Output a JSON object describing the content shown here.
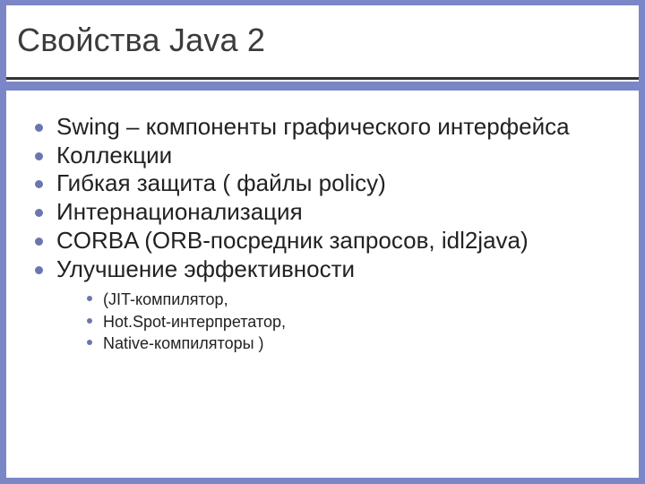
{
  "title": "Свойства Java 2",
  "bullets": {
    "main": [
      "Swing – компоненты графического интерфейса",
      "Коллекции",
      "Гибкая защита ( файлы policy)",
      "Интернационализация",
      "CORBA (ORB-посредник запросов, idl2java)",
      "Улучшение эффективности"
    ],
    "sub": [
      "(JIT-компилятор,",
      "Hot.Spot-интерпретатор,",
      "Native-компиляторы )"
    ]
  }
}
